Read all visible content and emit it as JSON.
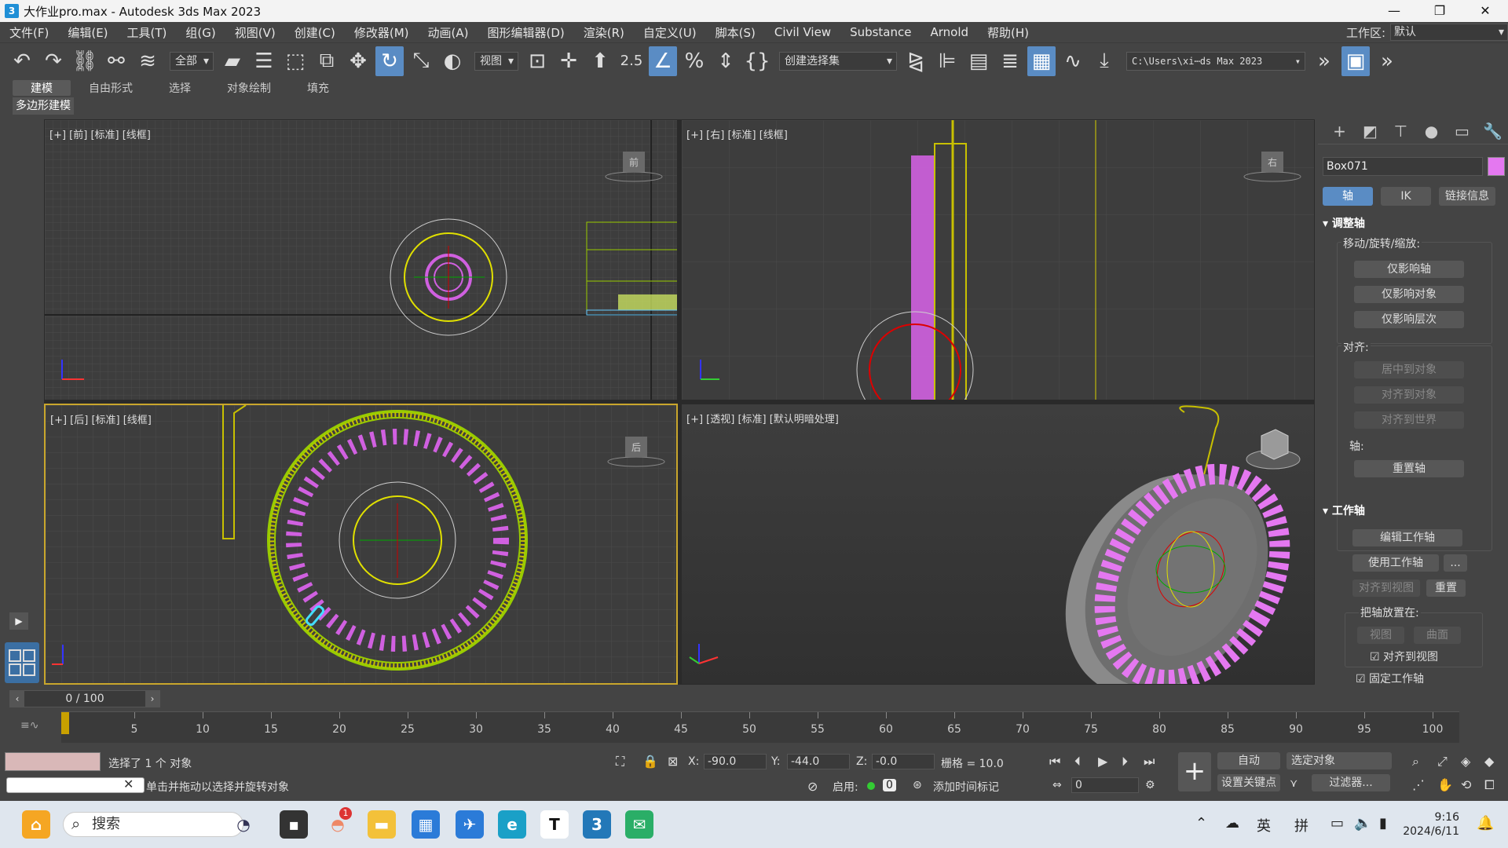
{
  "window": {
    "title": "大作业pro.max - Autodesk 3ds Max 2023",
    "app_icon": "3",
    "controls": [
      "—",
      "❐",
      "✕"
    ]
  },
  "menu": {
    "items": [
      "文件(F)",
      "编辑(E)",
      "工具(T)",
      "组(G)",
      "视图(V)",
      "创建(C)",
      "修改器(M)",
      "动画(A)",
      "图形编辑器(D)",
      "渲染(R)",
      "自定义(U)",
      "脚本(S)",
      "Civil View",
      "Substance",
      "Arnold",
      "帮助(H)"
    ],
    "workspace_label": "工作区:",
    "workspace_value": "默认"
  },
  "toolbar": {
    "selection_filter": "全部",
    "ref_coord": "视图",
    "named_sel": "创建选择集",
    "project_path": "C:\\Users\\xi⋯ds Max 2023",
    "snap_label": "2.5"
  },
  "ribbon": {
    "tabs": [
      "建模",
      "自由形式",
      "选择",
      "对象绘制",
      "填充"
    ],
    "sub": "多边形建模"
  },
  "viewports": {
    "front": "[+] [前] [标准] [线框]",
    "right": "[+] [右] [标准] [线框]",
    "back": "[+] [后] [标准] [线框]",
    "persp": "[+] [透视] [标准] [默认明暗处理]",
    "viewcube_front": "前",
    "viewcube_right": "右",
    "viewcube_back": "后"
  },
  "command_panel": {
    "object_name": "Box071",
    "object_color": "#e478f0",
    "tabs": [
      "轴",
      "IK",
      "链接信息"
    ],
    "adjust_pivot": {
      "title": "调整轴",
      "mode_label": "移动/旋转/缩放:",
      "buttons": [
        "仅影响轴",
        "仅影响对象",
        "仅影响层次"
      ],
      "align_label": "对齐:",
      "align_buttons": [
        "居中到对象",
        "对齐到对象",
        "对齐到世界"
      ],
      "pivot_label": "轴:",
      "reset": "重置轴"
    },
    "working_pivot": {
      "title": "工作轴",
      "edit": "编辑工作轴",
      "use": "使用工作轴",
      "more": "...",
      "align_view": "对齐到视图",
      "reset": "重置",
      "place_label": "把轴放置在:",
      "view": "视图",
      "surface": "曲面",
      "check_align": "对齐到视图",
      "check_fixed": "固定工作轴"
    }
  },
  "timeline": {
    "frame": "0 / 100",
    "ticks": [
      0,
      5,
      10,
      15,
      20,
      25,
      30,
      35,
      40,
      45,
      50,
      55,
      60,
      65,
      70,
      75,
      80,
      85,
      90,
      95,
      100
    ]
  },
  "status": {
    "selected": "选择了 1 个 对象",
    "prompt": "单击并拖动以选择并旋转对象",
    "x_label": "X:",
    "x": "-90.0",
    "y_label": "Y:",
    "y": "-44.0",
    "z_label": "Z:",
    "z": "-0.0",
    "grid": "栅格 = 10.0",
    "enable": "启用:",
    "add_time_tag": "添加时间标记",
    "auto": "自动",
    "set_key": "设置关键点",
    "sel_set": "选定对象",
    "filters": "过滤器...",
    "frame_field": "0"
  },
  "taskbar": {
    "search": "搜索",
    "lang": "英",
    "ime": "拼",
    "time": "9:16",
    "date": "2024/6/11",
    "badge": "1"
  }
}
